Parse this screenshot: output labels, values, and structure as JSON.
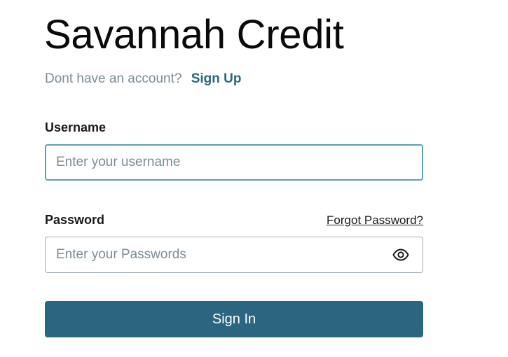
{
  "app": {
    "title": "Savannah Credit"
  },
  "signup": {
    "prompt": "Dont have an account?",
    "link_label": "Sign Up"
  },
  "username": {
    "label": "Username",
    "placeholder": "Enter your username",
    "value": ""
  },
  "password": {
    "label": "Password",
    "placeholder": "Enter your Passwords",
    "value": "",
    "forgot_label": "Forgot Password?",
    "toggle_icon": "eye-icon"
  },
  "actions": {
    "signin_label": "Sign In"
  },
  "colors": {
    "accent": "#2b6580",
    "focus_border": "#5fa0b9",
    "muted_text": "#7d8c96"
  }
}
